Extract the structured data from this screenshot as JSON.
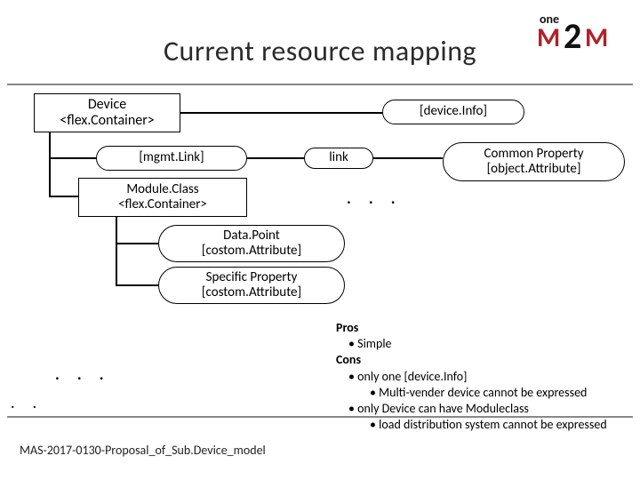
{
  "title": "Current resource mapping",
  "logo": {
    "one": "one",
    "m": "M",
    "two": "2",
    "m2": "M"
  },
  "nodes": {
    "device": {
      "line1": "Device",
      "line2": "<flex.Container>"
    },
    "deviceinfo": "[device.Info]",
    "mgmtlink": "[mgmt.Link]",
    "link": "link",
    "moduleclass": {
      "line1": "Module.Class",
      "line2": "<flex.Container>"
    },
    "datapoint": {
      "line1": "Data.Point",
      "line2": "[costom.Attribute]"
    },
    "specprop": {
      "line1": "Specific Property",
      "line2": "[costom.Attribute]"
    },
    "commonprop": {
      "line1": "Common Property",
      "line2": "[object.Attribute]"
    }
  },
  "dots": ".  .  .",
  "proscons": {
    "pros_hdr": "Pros",
    "pros1": "Simple",
    "cons_hdr": "Cons",
    "cons1": "only one [device.Info]",
    "cons1a": "Multi-vender device cannot be expressed",
    "cons2": "only Device can have Moduleclass",
    "cons2a": "load distribution system  cannot be expressed"
  },
  "footer": "MAS-2017-0130-Proposal_of_Sub.Device_model"
}
